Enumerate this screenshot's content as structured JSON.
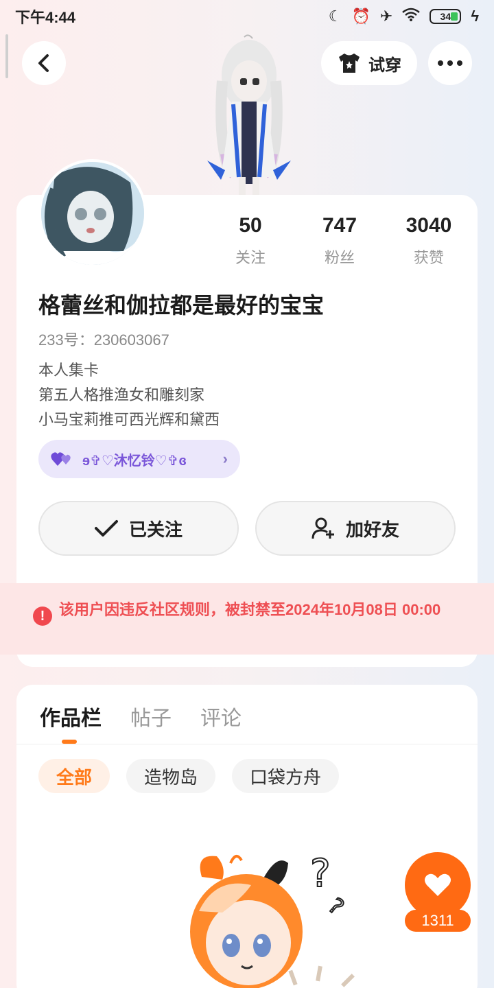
{
  "status_bar": {
    "time": "下午4:44",
    "battery": "34"
  },
  "header": {
    "try_on_label": "试穿"
  },
  "stats": [
    {
      "value": "50",
      "label": "关注"
    },
    {
      "value": "747",
      "label": "粉丝"
    },
    {
      "value": "3040",
      "label": "获赞"
    }
  ],
  "profile": {
    "nickname": "格蕾丝和伽拉都是最好的宝宝",
    "uid": "233号：230603067",
    "bio": [
      "本人集卡",
      "第五人格推渔女和雕刻家",
      "小马宝莉推可西光辉和黛西"
    ],
    "fan_tag": "ɘ✞♡沐忆铃♡✞ɞ"
  },
  "actions": {
    "follow_label": "已关注",
    "add_friend_label": "加好友"
  },
  "ban_notice": "该用户因违反社区规则，被封禁至2024年10月08日 00:00",
  "tabs": [
    "作品栏",
    "帖子",
    "评论"
  ],
  "filters": [
    "全部",
    "造物岛",
    "口袋方舟"
  ],
  "like": {
    "count": "1311"
  },
  "colors": {
    "accent": "#ff7a1a",
    "ban_red": "#ee4f53",
    "tag_purple": "#7a56d9"
  }
}
